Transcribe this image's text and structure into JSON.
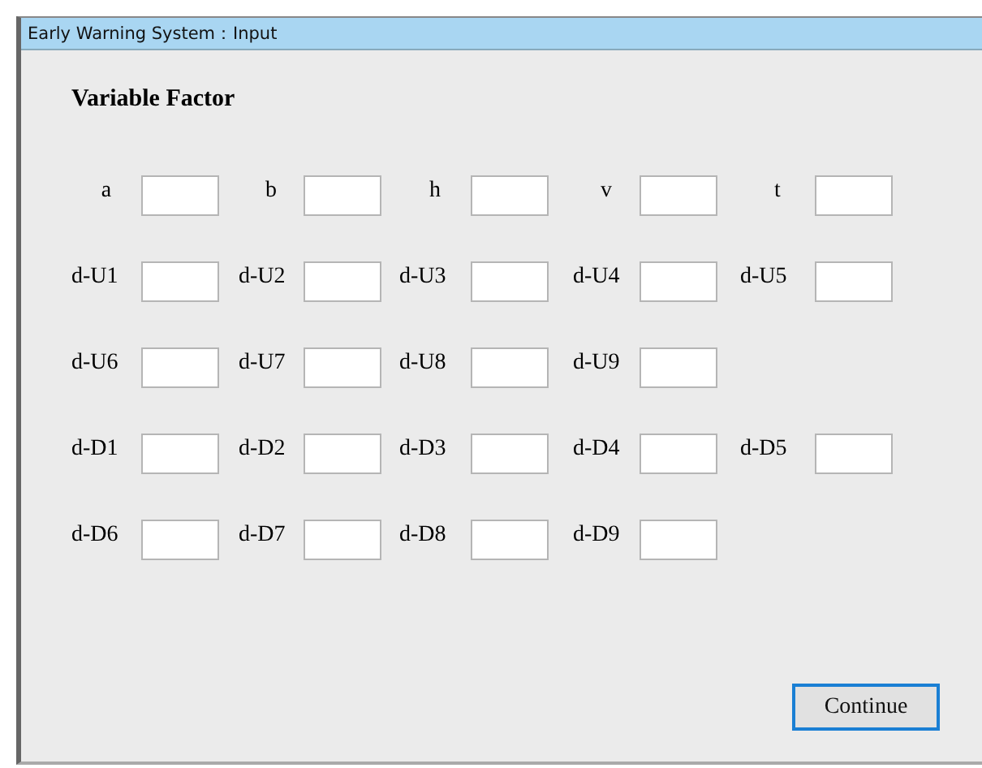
{
  "window": {
    "title": "Early Warning System：Input"
  },
  "heading": "Variable Factor",
  "rows": [
    [
      {
        "label": "a"
      },
      {
        "label": "b"
      },
      {
        "label": "h"
      },
      {
        "label": "v"
      },
      {
        "label": "t"
      }
    ],
    [
      {
        "label": "d-U1"
      },
      {
        "label": "d-U2"
      },
      {
        "label": "d-U3"
      },
      {
        "label": "d-U4"
      },
      {
        "label": "d-U5"
      }
    ],
    [
      {
        "label": "d-U6"
      },
      {
        "label": "d-U7"
      },
      {
        "label": "d-U8"
      },
      {
        "label": "d-U9"
      }
    ],
    [
      {
        "label": "d-D1"
      },
      {
        "label": "d-D2"
      },
      {
        "label": "d-D3"
      },
      {
        "label": "d-D4"
      },
      {
        "label": "d-D5"
      }
    ],
    [
      {
        "label": "d-D6"
      },
      {
        "label": "d-D7"
      },
      {
        "label": "d-D8"
      },
      {
        "label": "d-D9"
      }
    ]
  ],
  "button": {
    "label": "Continue",
    "focused": true
  }
}
